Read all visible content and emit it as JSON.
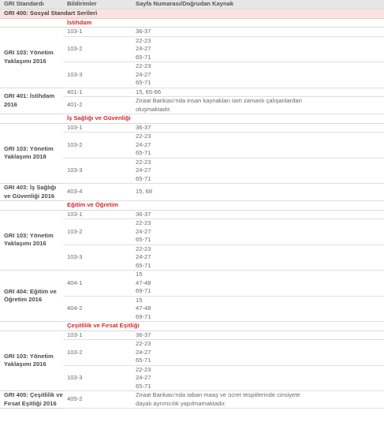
{
  "header": {
    "col1": "GRI Standardı",
    "col2": "Bildirimler",
    "col3": "Sayfa Numarası/Doğrudan Kaynak"
  },
  "series_title": "GRI 400: Sosyal Standart Serileri",
  "colors": {
    "accent": "#d8262c",
    "header_bg": "#e6e6e6",
    "series_bg": "#fbe2e2"
  },
  "sections": [
    {
      "title": "İstihdam",
      "standards": [
        {
          "name": "GRI 103: Yönetim Yaklaşımı 2016",
          "disclosures": [
            {
              "code": "103-1",
              "lines": [
                "36-37"
              ]
            },
            {
              "code": "103-2",
              "lines": [
                "22-23",
                "24-27",
                "65-71"
              ]
            },
            {
              "code": "103-3",
              "lines": [
                "22-23",
                "24-27",
                "65-71"
              ]
            }
          ]
        },
        {
          "name": "GRI 401: İstihdam 2016",
          "disclosures": [
            {
              "code": "401-1",
              "lines": [
                "15, 65-66"
              ]
            },
            {
              "code": "401-2",
              "lines": [
                "Ziraat Bankası'nda insan kaynakları tam zamanlı çalışanlardan",
                "oluşmaktadır."
              ]
            }
          ]
        }
      ]
    },
    {
      "title": "İş Sağlığı ve Güvenliği",
      "standards": [
        {
          "name": "GRI 103: Yönetim Yaklaşımı 2018",
          "disclosures": [
            {
              "code": "103-1",
              "lines": [
                "36-37"
              ]
            },
            {
              "code": "103-2",
              "lines": [
                "22-23",
                "24-27",
                "65-71"
              ]
            },
            {
              "code": "103-3",
              "lines": [
                "22-23",
                "24-27",
                "65-71"
              ]
            }
          ]
        },
        {
          "name": "GRI 403: İş Sağlığı ve Güvenliği 2016",
          "disclosures": [
            {
              "code": "403-4",
              "lines": [
                "15, 68"
              ]
            }
          ]
        }
      ]
    },
    {
      "title": "Eğitim ve Öğretim",
      "standards": [
        {
          "name": "GRI 103: Yönetim Yaklaşımı 2016",
          "disclosures": [
            {
              "code": "103-1",
              "lines": [
                "36-37"
              ]
            },
            {
              "code": "103-2",
              "lines": [
                "22-23",
                "24-27",
                "65-71"
              ]
            },
            {
              "code": "103-3",
              "lines": [
                "22-23",
                "24-27",
                "65-71"
              ]
            }
          ]
        },
        {
          "name": "GRI 404: Eğitim ve Öğretim 2016",
          "disclosures": [
            {
              "code": "404-1",
              "lines": [
                "15",
                "47-48",
                "69-71"
              ]
            },
            {
              "code": "404-2",
              "lines": [
                "15",
                "47-48",
                "69-71"
              ]
            }
          ]
        }
      ]
    },
    {
      "title": "Çeşitlilik ve Fırsat Eşitliği",
      "standards": [
        {
          "name": "GRI 103: Yönetim Yaklaşımı 2016",
          "disclosures": [
            {
              "code": "103-1",
              "lines": [
                "36-37"
              ]
            },
            {
              "code": "103-2",
              "lines": [
                "22-23",
                "24-27",
                "65-71"
              ]
            },
            {
              "code": "103-3",
              "lines": [
                "22-23",
                "24-27",
                "65-71"
              ]
            }
          ]
        },
        {
          "name": "GRI 405: Çeşitlilik ve Fırsat Eşitliği 2016",
          "disclosures": [
            {
              "code": "405-2",
              "lines": [
                "Ziraat Bankası'nda taban maaş ve ücret tespitlerinde cinsiyete",
                "dayalı ayrımcılık yapılmamaktadır."
              ]
            }
          ]
        }
      ]
    }
  ]
}
